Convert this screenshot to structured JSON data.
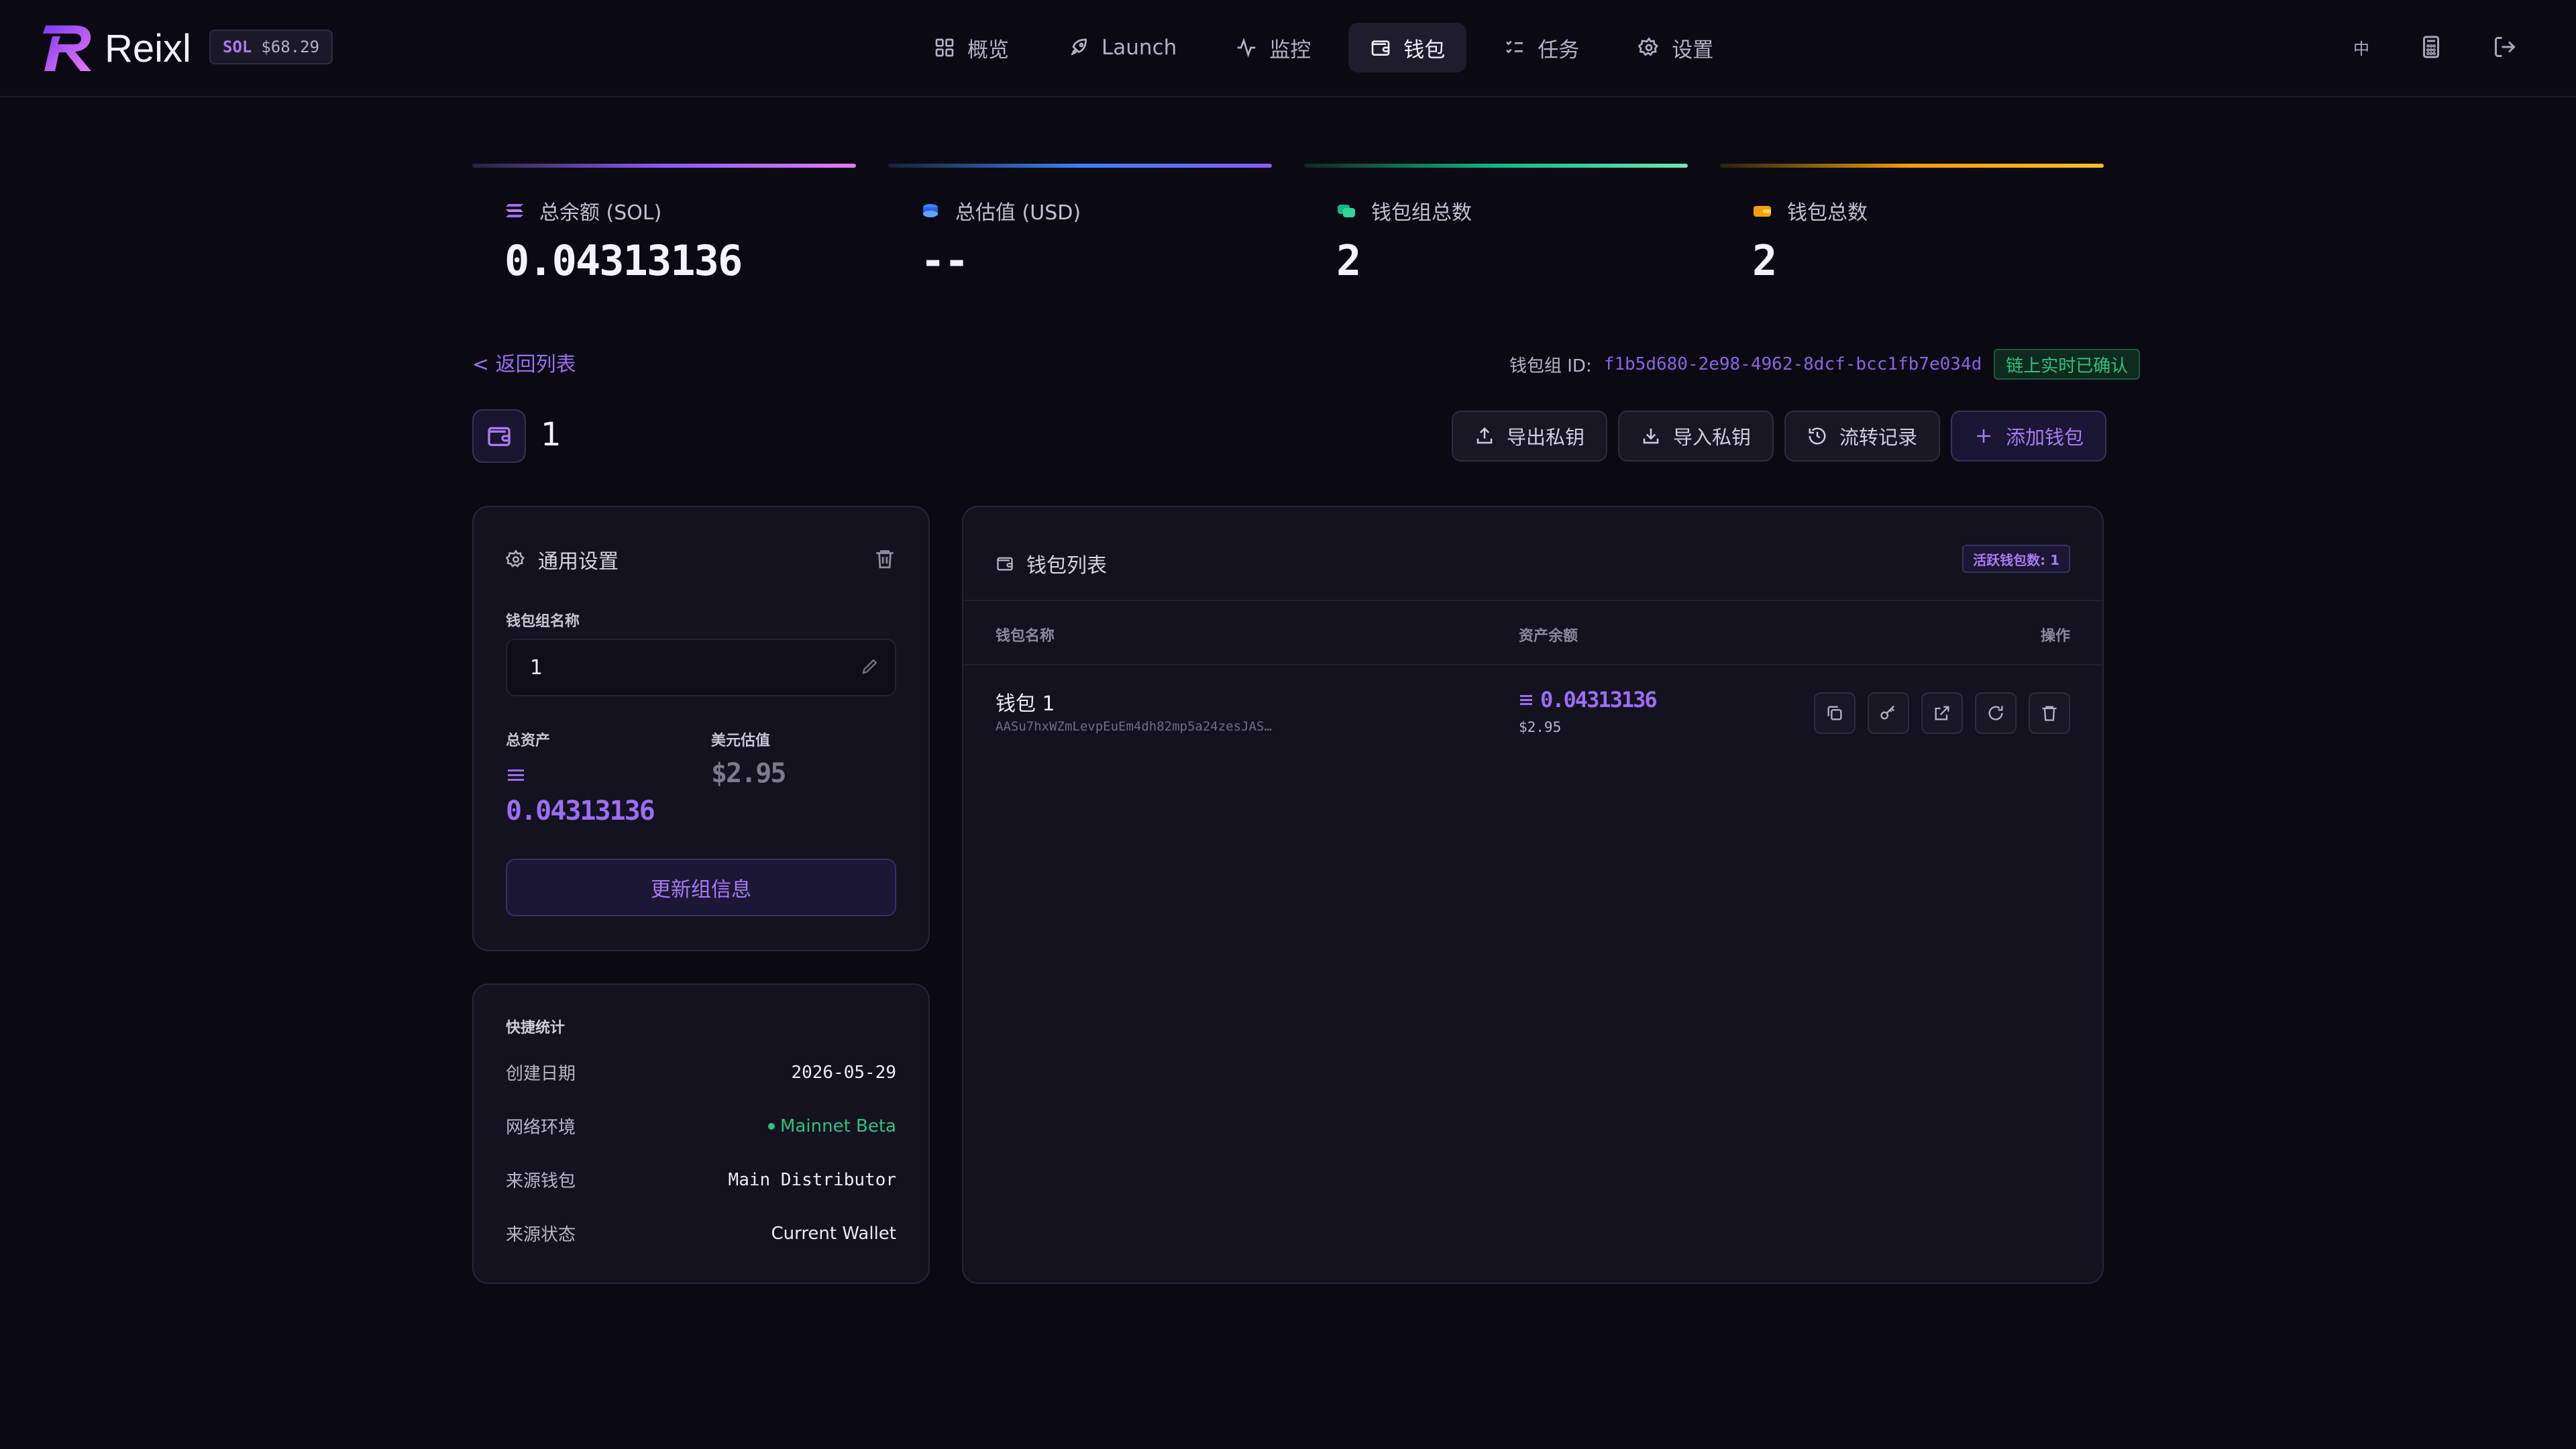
{
  "header": {
    "brand": "Reixl",
    "sol_badge": {
      "symbol": "SOL",
      "price": "$68.29"
    },
    "nav": [
      {
        "label": "概览",
        "icon": "grid-icon"
      },
      {
        "label": "Launch",
        "icon": "rocket-icon"
      },
      {
        "label": "监控",
        "icon": "activity-icon"
      },
      {
        "label": "钱包",
        "icon": "wallet-icon",
        "active": true
      },
      {
        "label": "任务",
        "icon": "list-checks-icon"
      },
      {
        "label": "设置",
        "icon": "gear-icon"
      }
    ],
    "lang": "中"
  },
  "stats": [
    {
      "label": "总余额 (SOL)",
      "value": "0.04313136",
      "accent": "#8b5cf6",
      "icon": "solana-icon"
    },
    {
      "label": "总估值 (USD)",
      "value": "--",
      "accent": "#3b82f6",
      "icon": "coins-icon"
    },
    {
      "label": "钱包组总数",
      "value": "2",
      "accent": "#10b981",
      "icon": "wallets-icon"
    },
    {
      "label": "钱包总数",
      "value": "2",
      "accent": "#f59e0b",
      "icon": "wallet-icon"
    }
  ],
  "back_label": "< 返回列表",
  "group_id": {
    "label": "钱包组 ID:",
    "value": "f1b5d680-2e98-4962-8dcf-bcc1fb7e034d",
    "badge": "链上实时已确认"
  },
  "group_title": "1",
  "actions": {
    "export": "导出私钥",
    "import": "导入私钥",
    "history": "流转记录",
    "add": "添加钱包"
  },
  "general": {
    "title": "通用设置",
    "name_label": "钱包组名称",
    "name_value": "1",
    "total_label": "总资产",
    "total_sol": "0.04313136",
    "usd_label": "美元估值",
    "usd_value": "$2.95",
    "update_label": "更新组信息"
  },
  "quick_stats": {
    "title": "快捷统计",
    "rows": [
      {
        "k": "创建日期",
        "v": "2026-05-29"
      },
      {
        "k": "网络环境",
        "v": "Mainnet Beta"
      },
      {
        "k": "来源钱包",
        "v": "Main Distributor"
      },
      {
        "k": "来源状态",
        "v": "Current Wallet"
      }
    ]
  },
  "wallet_list": {
    "title": "钱包列表",
    "active_badge": "活跃钱包数: 1",
    "columns": [
      "钱包名称",
      "资产余额",
      "操作"
    ],
    "rows": [
      {
        "name": "钱包 1",
        "address": "AASu7hxWZmLevpEuEm4dh82mp5a24zesJAS…",
        "sol": "0.04313136",
        "usd": "$2.95"
      }
    ]
  }
}
